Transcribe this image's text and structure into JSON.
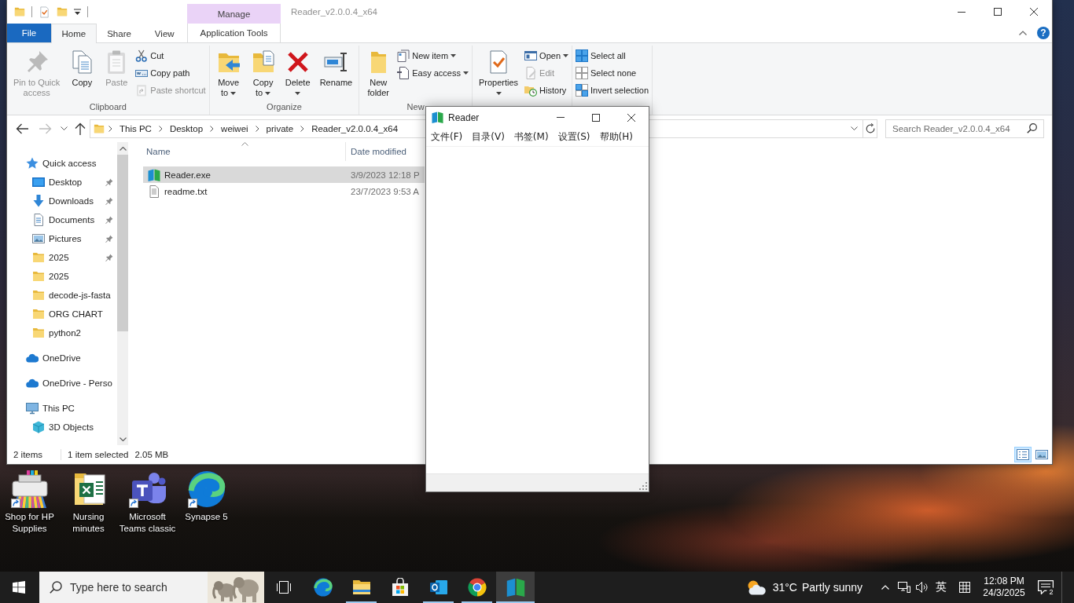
{
  "desktop": {
    "icons": [
      {
        "label": "Shop for HP Supplies",
        "shortcut": true
      },
      {
        "label": "Nursing minutes",
        "shortcut": false
      },
      {
        "label": "Microsoft Teams classic",
        "shortcut": true
      },
      {
        "label": "Synapse 5",
        "shortcut": true
      }
    ]
  },
  "explorer": {
    "title": "Reader_v2.0.0.4_x64",
    "context_group": "Manage",
    "help": "?",
    "tabs": [
      {
        "label": "File",
        "kind": "file",
        "selected": false
      },
      {
        "label": "Home",
        "kind": "tab",
        "selected": true
      },
      {
        "label": "Share",
        "kind": "tab",
        "selected": false
      },
      {
        "label": "View",
        "kind": "tab",
        "selected": false
      },
      {
        "label": "Application Tools",
        "kind": "context",
        "selected": false
      }
    ],
    "ribbon_groups": [
      {
        "label": "Clipboard",
        "commands": [
          {
            "kind": "large",
            "lines": [
              "Pin to Quick",
              "access"
            ],
            "dropdown": false,
            "disabled": true
          },
          {
            "kind": "large",
            "lines": [
              "Copy"
            ],
            "dropdown": false,
            "disabled": false
          },
          {
            "kind": "large",
            "lines": [
              "Paste"
            ],
            "dropdown": false,
            "disabled": true
          },
          {
            "kind": "small",
            "label": "Cut",
            "dropdown": false,
            "disabled": false
          },
          {
            "kind": "small",
            "label": "Copy path",
            "dropdown": false,
            "disabled": false
          },
          {
            "kind": "small",
            "label": "Paste shortcut",
            "dropdown": false,
            "disabled": true
          }
        ]
      },
      {
        "label": "Organize",
        "commands": [
          {
            "kind": "large",
            "lines": [
              "Move",
              "to"
            ],
            "dropdown": true,
            "disabled": false
          },
          {
            "kind": "large",
            "lines": [
              "Copy",
              "to"
            ],
            "dropdown": true,
            "disabled": false
          },
          {
            "kind": "large",
            "lines": [
              "Delete"
            ],
            "dropdown": true,
            "disabled": false
          },
          {
            "kind": "large",
            "lines": [
              "Rename"
            ],
            "dropdown": false,
            "disabled": false
          }
        ]
      },
      {
        "label": "New",
        "commands": [
          {
            "kind": "large",
            "lines": [
              "New",
              "folder"
            ],
            "dropdown": false,
            "disabled": false
          },
          {
            "kind": "small",
            "label": "New item",
            "dropdown": true,
            "disabled": false
          },
          {
            "kind": "small",
            "label": "Easy access",
            "dropdown": true,
            "disabled": false
          }
        ]
      },
      {
        "commands": [
          {
            "kind": "large",
            "lines": [
              "Properties"
            ],
            "dropdown": true,
            "disabled": false
          },
          {
            "kind": "small",
            "label": "Open",
            "dropdown": true,
            "disabled": false
          },
          {
            "kind": "small",
            "label": "Edit",
            "dropdown": false,
            "disabled": true
          },
          {
            "kind": "small",
            "label": "History",
            "dropdown": false,
            "disabled": false
          }
        ]
      },
      {
        "commands": [
          {
            "kind": "small",
            "label": "Select all",
            "dropdown": false,
            "disabled": false
          },
          {
            "kind": "small",
            "label": "Select none",
            "dropdown": false,
            "disabled": false
          },
          {
            "kind": "small",
            "label": "Invert selection",
            "dropdown": false,
            "disabled": false
          }
        ]
      }
    ],
    "back": {
      "disabled": false
    },
    "forward": {
      "disabled": true
    },
    "breadcrumb": [
      "This PC",
      "Desktop",
      "weiwei",
      "private",
      "Reader_v2.0.0.4_x64"
    ],
    "search": {
      "placeholder": "Search Reader_v2.0.0.4_x64"
    },
    "navigation_pane": [
      {
        "label": "Quick access",
        "children": [
          {
            "label": "Desktop",
            "pinned": true
          },
          {
            "label": "Downloads",
            "pinned": true
          },
          {
            "label": "Documents",
            "pinned": true
          },
          {
            "label": "Pictures",
            "pinned": true
          },
          {
            "label": "2025",
            "pinned": true
          },
          {
            "label": "2025",
            "pinned": false
          },
          {
            "label": "decode-js-fasta",
            "pinned": false
          },
          {
            "label": "ORG CHART",
            "pinned": false
          },
          {
            "label": "python2",
            "pinned": false
          }
        ]
      },
      {
        "label": "OneDrive"
      },
      {
        "label": "OneDrive - Perso"
      },
      {
        "label": "This PC",
        "children": [
          {
            "label": "3D Objects"
          }
        ]
      }
    ],
    "columns": [
      {
        "label": "Name",
        "sorted": true
      },
      {
        "label": "Date modified",
        "sorted": false
      }
    ],
    "files": [
      {
        "name": "Reader.exe",
        "date_modified": "3/9/2023 12:18 P",
        "selected": true
      },
      {
        "name": "readme.txt",
        "date_modified": "23/7/2023 9:53 A",
        "selected": false
      }
    ],
    "status_bar": {
      "item_count": "2 items",
      "selection": "1 item selected",
      "size": "2.05 MB",
      "views": [
        {
          "selected": true
        },
        {
          "selected": false
        }
      ]
    }
  },
  "reader": {
    "title": "Reader",
    "menu": [
      "文件(F)",
      "目录(V)",
      "书签(M)",
      "设置(S)",
      "帮助(H)"
    ]
  },
  "taskbar": {
    "search": {
      "placeholder": "Type here to search"
    },
    "apps": [
      {
        "running": false,
        "selected": false
      },
      {
        "running": true,
        "selected": false
      },
      {
        "running": false,
        "selected": false
      },
      {
        "running": true,
        "selected": false
      },
      {
        "running": true,
        "selected": false
      },
      {
        "running": true,
        "selected": true
      }
    ],
    "weather": {
      "temperature": "31°C",
      "condition": "Partly sunny"
    },
    "ime": "英",
    "clock": {
      "time": "12:08 PM",
      "date": "24/3/2025"
    },
    "notifications": "2"
  }
}
